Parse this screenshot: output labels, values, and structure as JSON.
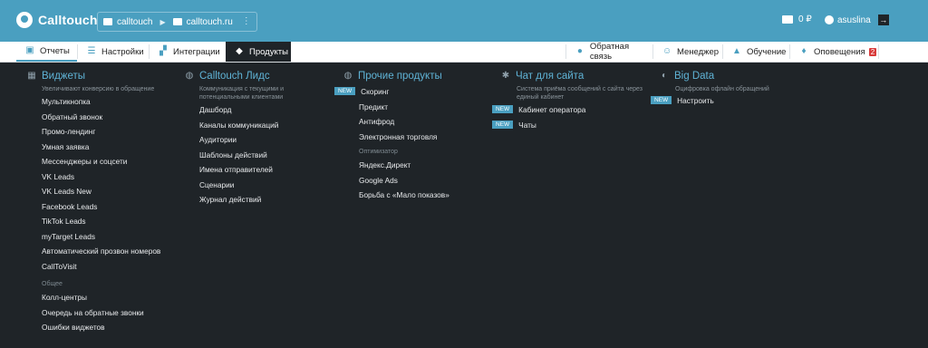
{
  "brand": {
    "name": "Calltouch"
  },
  "project": {
    "site": "calltouch",
    "domain": "calltouch.ru"
  },
  "account": {
    "balance": "0 ₽",
    "user": "asuslina"
  },
  "nav_tabs": [
    "Отчеты",
    "Настройки",
    "Интеграции",
    "Продукты"
  ],
  "right_tabs": [
    "Обратная связь",
    "Менеджер",
    "Обучение",
    "Оповещения"
  ],
  "notifications_count": "2",
  "columns": {
    "widgets": {
      "title": "Виджеты",
      "desc": "Увеличивают конверсию в обращение",
      "items": [
        "Мультикнопка",
        "Обратный звонок",
        "Промо-лендинг",
        "Умная заявка",
        "Мессенджеры и соцсети",
        "VK Leads",
        "VK Leads New",
        "Facebook Leads",
        "TikTok Leads",
        "myTarget Leads",
        "Автоматический прозвон номеров",
        "CallToVisit"
      ],
      "group": "Общее",
      "group_items": [
        "Колл-центры",
        "Очередь на обратные звонки",
        "Ошибки виджетов"
      ]
    },
    "leads": {
      "title": "Calltouch Лидс",
      "desc_lines": [
        "Коммуникация с текущими и",
        "потенциальными клиентами"
      ],
      "items": [
        "Дашборд",
        "Каналы коммуникаций",
        "Аудитории",
        "Шаблоны действий",
        "Имена отправителей",
        "Сценарии",
        "Журнал действий"
      ]
    },
    "other": {
      "title": "Прочие продукты",
      "new_label": "NEW",
      "items": [
        "Скоринг",
        "Предикт",
        "Антифрод",
        "Электронная торговля"
      ],
      "group": "Оптимизатор",
      "group_items": [
        "Яндекс.Директ",
        "Google Ads",
        "Борьба с «Мало показов»"
      ]
    },
    "chat": {
      "title": "Чат для сайта",
      "desc_lines": [
        "Система приёма сообщений с сайта через",
        "единый кабинет"
      ],
      "items": [
        "Кабинет оператора",
        "Чаты"
      ]
    },
    "bigdata": {
      "title": "Big Data",
      "desc": "Оцифровка офлайн обращений",
      "items": [
        "Настроить"
      ]
    }
  }
}
